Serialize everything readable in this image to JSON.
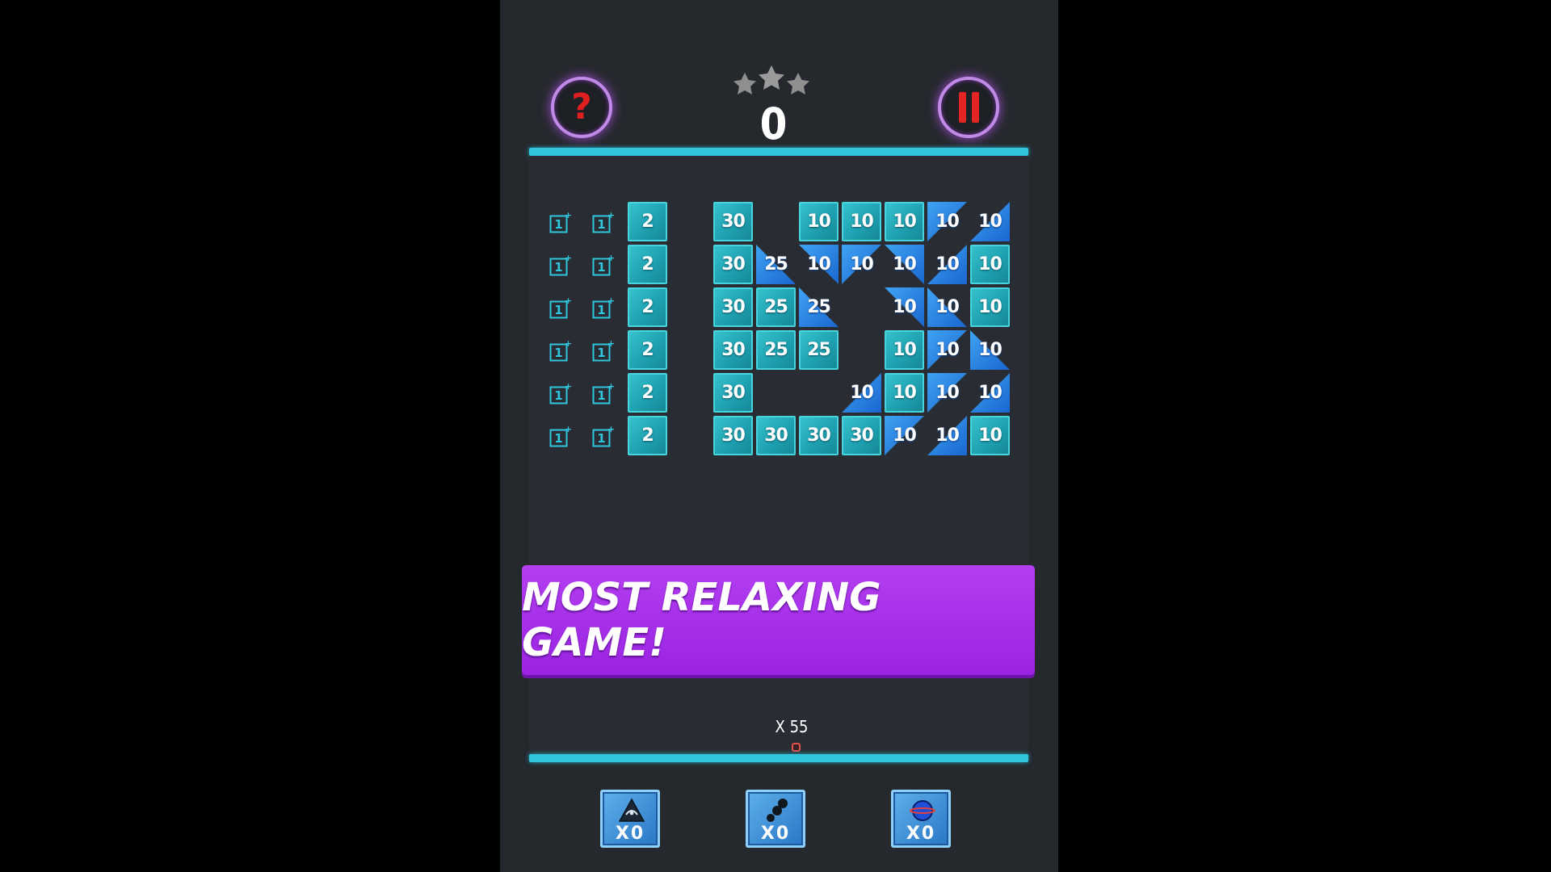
{
  "hud": {
    "score": "0",
    "stars_earned": 0,
    "stars_total": 3,
    "help_label": "?",
    "colors": {
      "circle_button": "#c08ae6",
      "icon_red": "#e02020",
      "bar_cyan": "#2fc6de"
    }
  },
  "board": {
    "rows": [
      {
        "pickups": [
          "1+",
          "1+"
        ],
        "left_brick": "2",
        "cells": [
          {
            "v": "30",
            "s": "sq"
          },
          {
            "v": null
          },
          {
            "v": "10",
            "s": "sq"
          },
          {
            "v": "10",
            "s": "sq"
          },
          {
            "v": "10",
            "s": "sq"
          },
          {
            "v": "10",
            "s": "tl"
          },
          {
            "v": "10",
            "s": "br"
          }
        ]
      },
      {
        "pickups": [
          "1+",
          "1+"
        ],
        "left_brick": "2",
        "cells": [
          {
            "v": "30",
            "s": "sq"
          },
          {
            "v": "25",
            "s": "bl"
          },
          {
            "v": "10",
            "s": "tr"
          },
          {
            "v": "10",
            "s": "tl"
          },
          {
            "v": "10",
            "s": "tr"
          },
          {
            "v": "10",
            "s": "br"
          },
          {
            "v": "10",
            "s": "sq"
          }
        ]
      },
      {
        "pickups": [
          "1+",
          "1+"
        ],
        "left_brick": "2",
        "cells": [
          {
            "v": "30",
            "s": "sq"
          },
          {
            "v": "25",
            "s": "sq"
          },
          {
            "v": "25",
            "s": "bl"
          },
          {
            "v": null
          },
          {
            "v": "10",
            "s": "tr"
          },
          {
            "v": "10",
            "s": "bl"
          },
          {
            "v": "10",
            "s": "sq"
          }
        ]
      },
      {
        "pickups": [
          "1+",
          "1+"
        ],
        "left_brick": "2",
        "cells": [
          {
            "v": "30",
            "s": "sq"
          },
          {
            "v": "25",
            "s": "sq"
          },
          {
            "v": "25",
            "s": "sq"
          },
          {
            "v": null
          },
          {
            "v": "10",
            "s": "sq"
          },
          {
            "v": "10",
            "s": "tl"
          },
          {
            "v": "10",
            "s": "bl"
          }
        ]
      },
      {
        "pickups": [
          "1+",
          "1+"
        ],
        "left_brick": "2",
        "cells": [
          {
            "v": "30",
            "s": "sq"
          },
          {
            "v": null
          },
          {
            "v": null
          },
          {
            "v": "10",
            "s": "br"
          },
          {
            "v": "10",
            "s": "sq"
          },
          {
            "v": "10",
            "s": "tl"
          },
          {
            "v": "10",
            "s": "br"
          }
        ]
      },
      {
        "pickups": [
          "1+",
          "1+"
        ],
        "left_brick": "2",
        "cells": [
          {
            "v": "30",
            "s": "sq"
          },
          {
            "v": "30",
            "s": "sq"
          },
          {
            "v": "30",
            "s": "sq"
          },
          {
            "v": "30",
            "s": "sq"
          },
          {
            "v": "10",
            "s": "tl"
          },
          {
            "v": "10",
            "s": "br"
          },
          {
            "v": "10",
            "s": "sq"
          }
        ]
      }
    ],
    "colors": {
      "brick": "#1fa1b1",
      "triangle": "#2a7fe0"
    }
  },
  "banner": {
    "text": "MOST RELAXING GAME!",
    "color": "#a52de8"
  },
  "launcher": {
    "ball_count": "X 55"
  },
  "powerups": [
    {
      "icon": "laser-pyramid-icon",
      "count": "X0"
    },
    {
      "icon": "ball-split-icon",
      "count": "X0"
    },
    {
      "icon": "ring-orb-icon",
      "count": "X0"
    }
  ]
}
